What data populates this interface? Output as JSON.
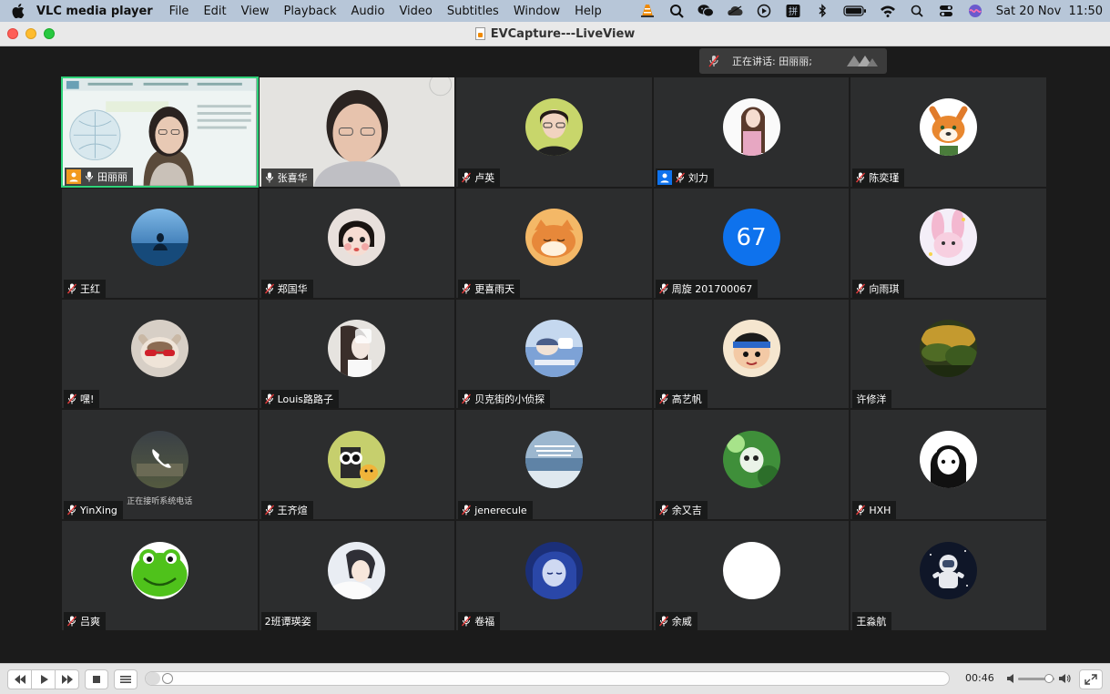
{
  "menubar": {
    "app_name": "VLC media player",
    "menus": [
      "File",
      "Edit",
      "View",
      "Playback",
      "Audio",
      "Video",
      "Subtitles",
      "Window",
      "Help"
    ],
    "clock": "Sat 20 Nov  11:50",
    "status_icons": [
      "vlc-cone-icon",
      "search-zoom-icon",
      "wechat-icon",
      "cloud-icon",
      "play-circle-icon",
      "input-method-icon",
      "bluetooth-icon",
      "battery-icon",
      "wifi-icon",
      "spotlight-search-icon",
      "control-center-icon",
      "siri-icon"
    ]
  },
  "window": {
    "title": "EVCapture---LiveView"
  },
  "meeting": {
    "speaking_label": "正在讲话: 田丽丽;",
    "participants": [
      {
        "name": "田丽丽",
        "host": true,
        "host_color": "#f29a1d",
        "mic": "on",
        "avatar": "video-slide",
        "active": true
      },
      {
        "name": "张喜华",
        "host": false,
        "mic": "on",
        "avatar": "video-webcam"
      },
      {
        "name": "卢英",
        "host": false,
        "mic": "muted",
        "avatar": "avatar-woman-glasses"
      },
      {
        "name": "刘力",
        "host": true,
        "host_color": "#0e72ed",
        "mic": "muted",
        "avatar": "avatar-girl-pink"
      },
      {
        "name": "陈奕瑾",
        "host": false,
        "mic": "muted",
        "avatar": "avatar-fox"
      },
      {
        "name": "王红",
        "host": false,
        "mic": "muted",
        "avatar": "avatar-sea-silhouette"
      },
      {
        "name": "郑国华",
        "host": false,
        "mic": "muted",
        "avatar": "avatar-child"
      },
      {
        "name": "更喜雨天",
        "host": false,
        "mic": "muted",
        "avatar": "avatar-cat-sleeping"
      },
      {
        "name": "周旋 201700067",
        "host": false,
        "mic": "muted",
        "avatar": "number",
        "number": "67"
      },
      {
        "name": "向雨琪",
        "host": false,
        "mic": "muted",
        "avatar": "avatar-bunny"
      },
      {
        "name": "嘿!",
        "host": false,
        "mic": "muted",
        "avatar": "avatar-cat-sunglasses"
      },
      {
        "name": "Louis路路子",
        "host": false,
        "mic": "muted",
        "avatar": "avatar-girl-mirror"
      },
      {
        "name": "贝克街的小侦探",
        "host": false,
        "mic": "muted",
        "avatar": "avatar-anime-sleep"
      },
      {
        "name": "高艺帆",
        "host": false,
        "mic": "muted",
        "avatar": "avatar-cartoon-boy"
      },
      {
        "name": "许修洋",
        "host": false,
        "mic": "none",
        "avatar": "avatar-landscape"
      },
      {
        "name": "YinXing",
        "host": false,
        "mic": "muted",
        "avatar": "avatar-phone-call",
        "note": "正在接听系统电话"
      },
      {
        "name": "王齐煊",
        "host": false,
        "mic": "muted",
        "avatar": "avatar-owl"
      },
      {
        "name": "jenerecule",
        "host": false,
        "mic": "muted",
        "avatar": "avatar-sea-text"
      },
      {
        "name": "余又吉",
        "host": false,
        "mic": "muted",
        "avatar": "avatar-green-toy"
      },
      {
        "name": "HXH",
        "host": false,
        "mic": "muted",
        "avatar": "avatar-anime-girl"
      },
      {
        "name": "吕爽",
        "host": false,
        "mic": "muted",
        "avatar": "avatar-green-frog"
      },
      {
        "name": "2班谭瑛姿",
        "host": false,
        "mic": "none",
        "avatar": "avatar-anime-boy"
      },
      {
        "name": "卷福",
        "host": false,
        "mic": "muted",
        "avatar": "avatar-anime-blue"
      },
      {
        "name": "余威",
        "host": false,
        "mic": "muted",
        "avatar": "avatar-white"
      },
      {
        "name": "王淼航",
        "host": false,
        "mic": "none",
        "avatar": "avatar-astronaut"
      }
    ]
  },
  "player": {
    "time": "00:46",
    "seek_progress": 0.018,
    "volume_level": 0.85
  }
}
